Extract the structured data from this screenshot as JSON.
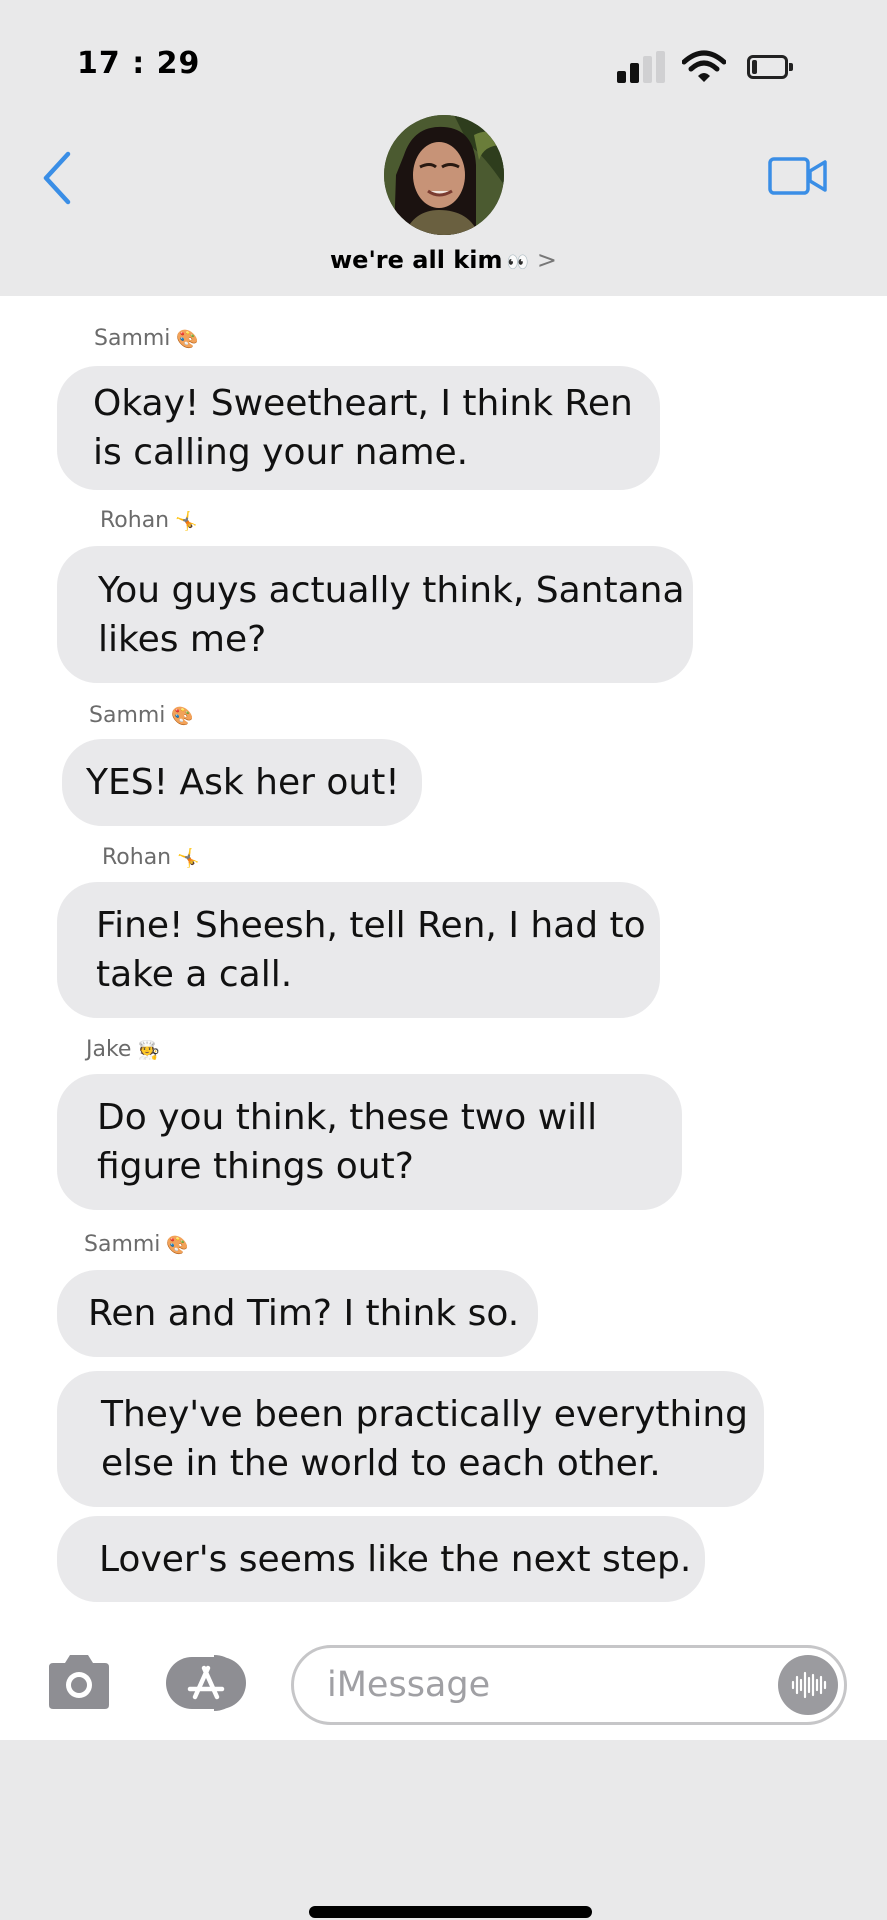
{
  "status_bar": {
    "time": "17 : 29",
    "signal_icon": "cellular-signal-icon",
    "wifi_icon": "wifi-icon",
    "battery_icon": "battery-low-icon",
    "battery_level": 0.1
  },
  "header": {
    "back_icon": "chevron-left-icon",
    "group_name": "we're all kim",
    "group_emoji": "👀",
    "chevron": ">",
    "video_icon": "video-camera-icon",
    "accent_color": "#3a8ee6"
  },
  "messages": [
    {
      "sender": "Sammi",
      "emoji": "🎨",
      "text_lines": [
        "Okay! Sweetheart, I think Ren",
        "is calling your name."
      ]
    },
    {
      "sender": "Rohan",
      "emoji": "🤸",
      "text_lines": [
        "You guys actually think, Santana",
        "likes me?"
      ]
    },
    {
      "sender": "Sammi",
      "emoji": "🎨",
      "text_lines": [
        "YES! Ask her out!"
      ]
    },
    {
      "sender": "Rohan",
      "emoji": "🤸",
      "text_lines": [
        "Fine! Sheesh, tell Ren, I had to",
        "take a call."
      ]
    },
    {
      "sender": "Jake",
      "emoji": "🧑‍🍳",
      "text_lines": [
        "Do you think, these two will",
        "figure things out?"
      ]
    },
    {
      "sender": "Sammi",
      "emoji": "🎨",
      "text_lines": [
        "Ren and Tim? I think so."
      ]
    },
    {
      "sender": "",
      "emoji": "",
      "text_lines": [
        "They've been practically everything",
        "else in the world to each other."
      ]
    },
    {
      "sender": "",
      "emoji": "",
      "text_lines": [
        "Lover's seems like the next step."
      ]
    }
  ],
  "input_bar": {
    "camera_icon": "camera-icon",
    "apps_icon": "app-store-icon",
    "placeholder": "iMessage",
    "audio_icon": "audio-waveform-icon"
  },
  "colors": {
    "header_bg": "#e9e9ea",
    "bubble_bg": "#e9e9eb",
    "accent": "#3a8ee6"
  }
}
